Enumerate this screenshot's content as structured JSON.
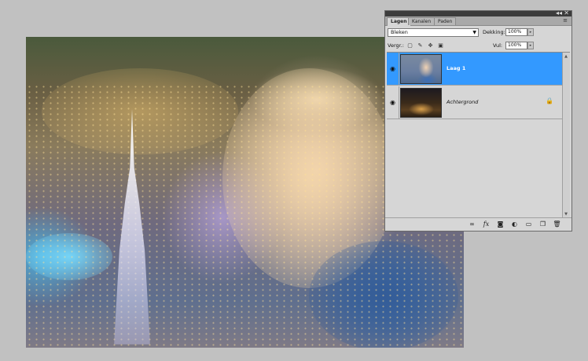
{
  "panel": {
    "collapse_glyph": "◂◂",
    "close_glyph": "✕",
    "tabs": [
      {
        "label": "Lagen",
        "active": true
      },
      {
        "label": "Kanalen",
        "active": false
      },
      {
        "label": "Paden",
        "active": false
      }
    ],
    "menu_glyph": "≡",
    "blend_mode": "Bleken",
    "dropdown_glyph": "▼",
    "opacity_label": "Dekking:",
    "opacity_value": "100%",
    "lock_label": "Vergr.:",
    "fill_label": "Vul:",
    "fill_value": "100%",
    "spin_glyph": "▸",
    "layers": [
      {
        "name": "Laag 1",
        "selected": true,
        "visible": true,
        "locked": false
      },
      {
        "name": "Achtergrond",
        "selected": false,
        "visible": true,
        "locked": true
      }
    ],
    "eye_glyph": "◉",
    "lock_glyph": "🔒",
    "scroll_up": "▲",
    "scroll_down": "▼"
  },
  "icons": {
    "footer": [
      "link-icon",
      "fx-icon",
      "mask-icon",
      "adjustment-icon",
      "group-icon",
      "new-layer-icon",
      "trash-icon"
    ],
    "lock_buttons": [
      "lock-transparent-icon",
      "lock-brush-icon",
      "lock-move-icon",
      "lock-all-icon"
    ]
  },
  "colors": {
    "selection": "#3399ff",
    "panel_bg": "#d6d6d6",
    "workspace_bg": "#c1c1c1"
  }
}
